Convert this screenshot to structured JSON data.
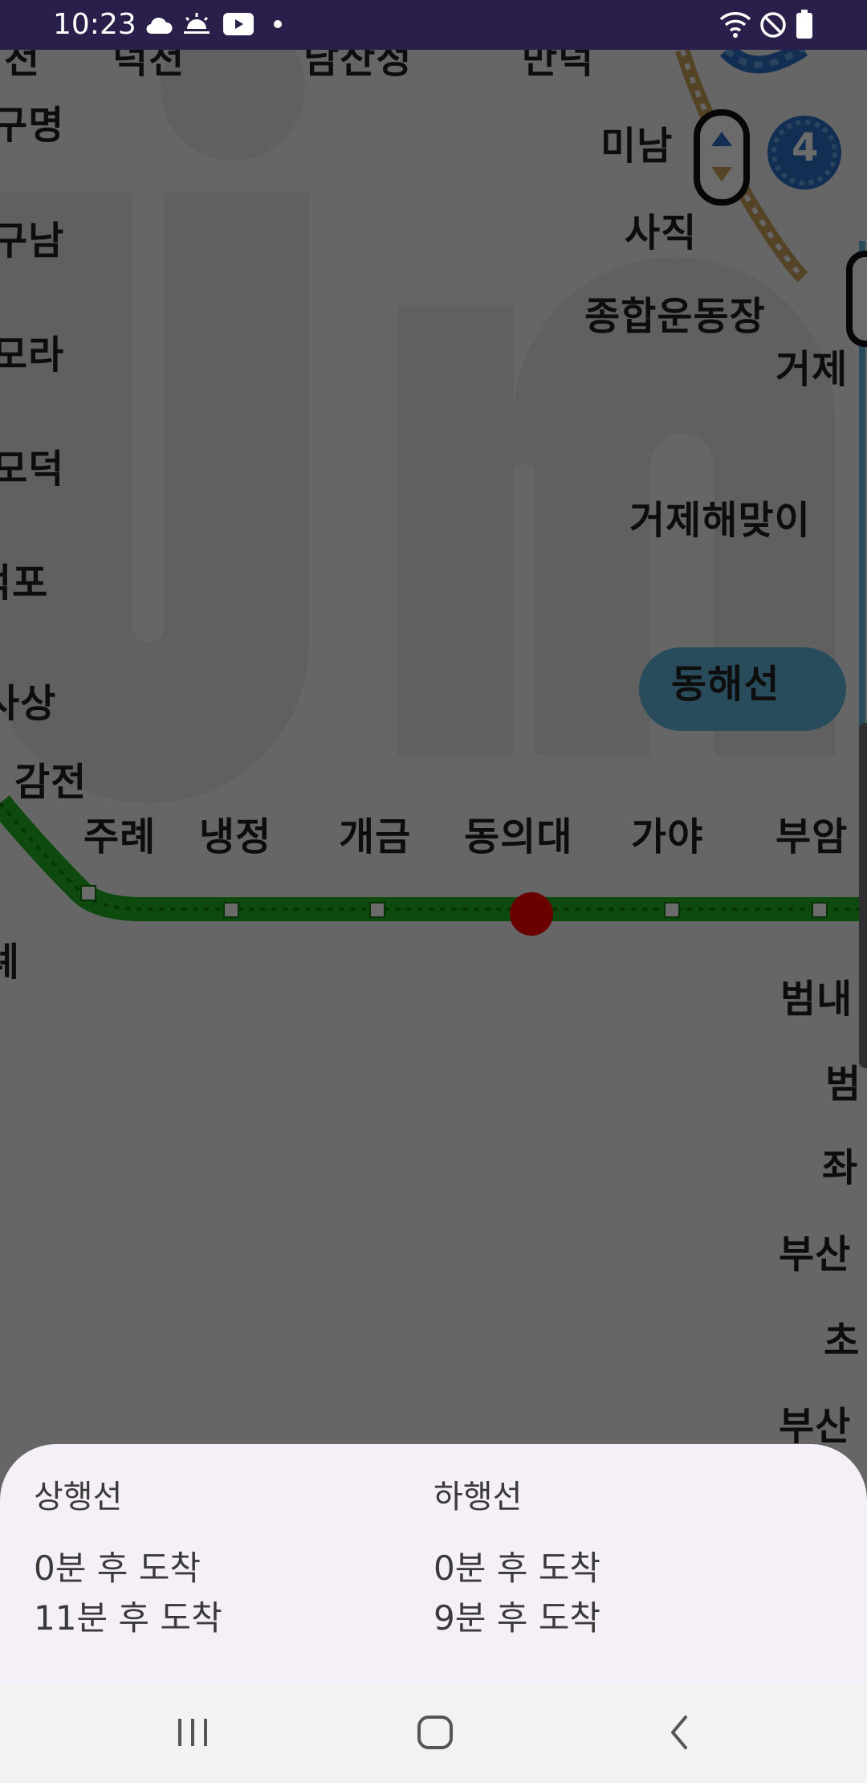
{
  "status_bar": {
    "time": "10:23",
    "left_icons": [
      "cloud-icon",
      "sunrise-icon",
      "youtube-icon",
      "dot-icon"
    ],
    "right_icons": [
      "wifi-icon",
      "do-not-disturb-icon",
      "battery-icon"
    ]
  },
  "map": {
    "line_badge": "4",
    "line_colors": {
      "line2": "#22b022",
      "line3": "#c9a15a",
      "line4": "#2b6fc7",
      "donghae": "#5fb6dc"
    },
    "selected_station_marker_color": "#ff0000",
    "line_name_badge": "동해선",
    "stations": {
      "top_partial_1": "구남",
      "top_partial_2": "덕천",
      "top_partial_3": "구명",
      "top_partial_4": "구남",
      "top_partial_5": "모라",
      "top_partial_6": "모덕",
      "top_partial_7": "덕포",
      "top_partial_8": "사상",
      "gamjeon": "감전",
      "jurye": "주례",
      "naengjeong": "냉정",
      "gaegeum": "개금",
      "dongeui": "동의대",
      "gaya": "가야",
      "buam": "부암",
      "partial_left_de": "례",
      "mi_nam": "미남",
      "sajik": "사직",
      "sports_complex": "종합운동장",
      "geoje": "거제",
      "geoje_haemaji": "거제해맞이",
      "beomnae": "범내",
      "beom": "범",
      "jwa": "좌",
      "busan1": "부산",
      "cho": "초",
      "busan2": "부산",
      "top_a": "덕천",
      "top_b": "남산정",
      "top_c": "만덕"
    }
  },
  "sheet": {
    "up": {
      "title": "상행선",
      "arrivals": [
        "0분 후 도착",
        "11분 후 도착"
      ]
    },
    "down": {
      "title": "하행선",
      "arrivals": [
        "0분 후 도착",
        "9분 후 도착"
      ]
    }
  },
  "nav": {
    "recent_icon": "recent-apps-icon",
    "home_icon": "home-icon",
    "back_icon": "back-icon"
  }
}
